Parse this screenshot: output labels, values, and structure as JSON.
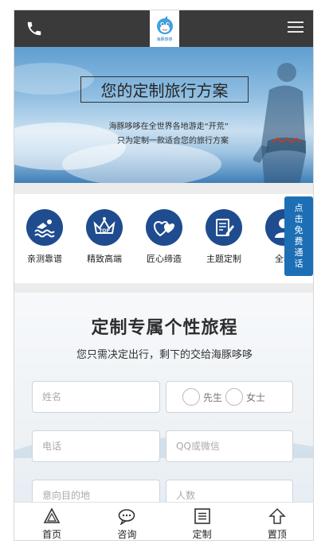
{
  "header": {
    "phone_icon": "phone-icon",
    "logo_text": "海豚哆哆",
    "menu_icon": "hamburger-menu-icon",
    "background_color": "#3a3a3a"
  },
  "banner": {
    "title": "您的定制旅行方案",
    "line1": "海豚哆哆在全世界各地游走“开荒”",
    "line2": "只为定制一款适合您的旅行方案"
  },
  "features": [
    {
      "label": "亲测靠谱",
      "icon": "swimmer-icon"
    },
    {
      "label": "精致高端",
      "icon": "top-crown-icon"
    },
    {
      "label": "匠心缔造",
      "icon": "hearts-icon"
    },
    {
      "label": "主题定制",
      "icon": "document-pen-icon"
    },
    {
      "label": "全程",
      "icon": "person-service-icon"
    }
  ],
  "free_call": {
    "label": "点击免费通话",
    "color": "#1d6fb5"
  },
  "form": {
    "title": "定制专属个性旅程",
    "subtitle": "您只需决定出行，剩下的交给海豚哆哆",
    "name_placeholder": "姓名",
    "gender_male": "先生",
    "gender_female": "女士",
    "phone_placeholder": "电话",
    "contact_placeholder": "QQ或微信",
    "destination_placeholder": "意向目的地",
    "people_placeholder": "人数"
  },
  "bottom_nav": [
    {
      "label": "首页",
      "icon": "home-triangle-icon"
    },
    {
      "label": "咨询",
      "icon": "chat-bubble-icon"
    },
    {
      "label": "定制",
      "icon": "list-icon"
    },
    {
      "label": "置顶",
      "icon": "arrow-up-icon"
    }
  ],
  "colors": {
    "accent": "#1f4c8f",
    "brand_blue": "#1d6fb5"
  }
}
